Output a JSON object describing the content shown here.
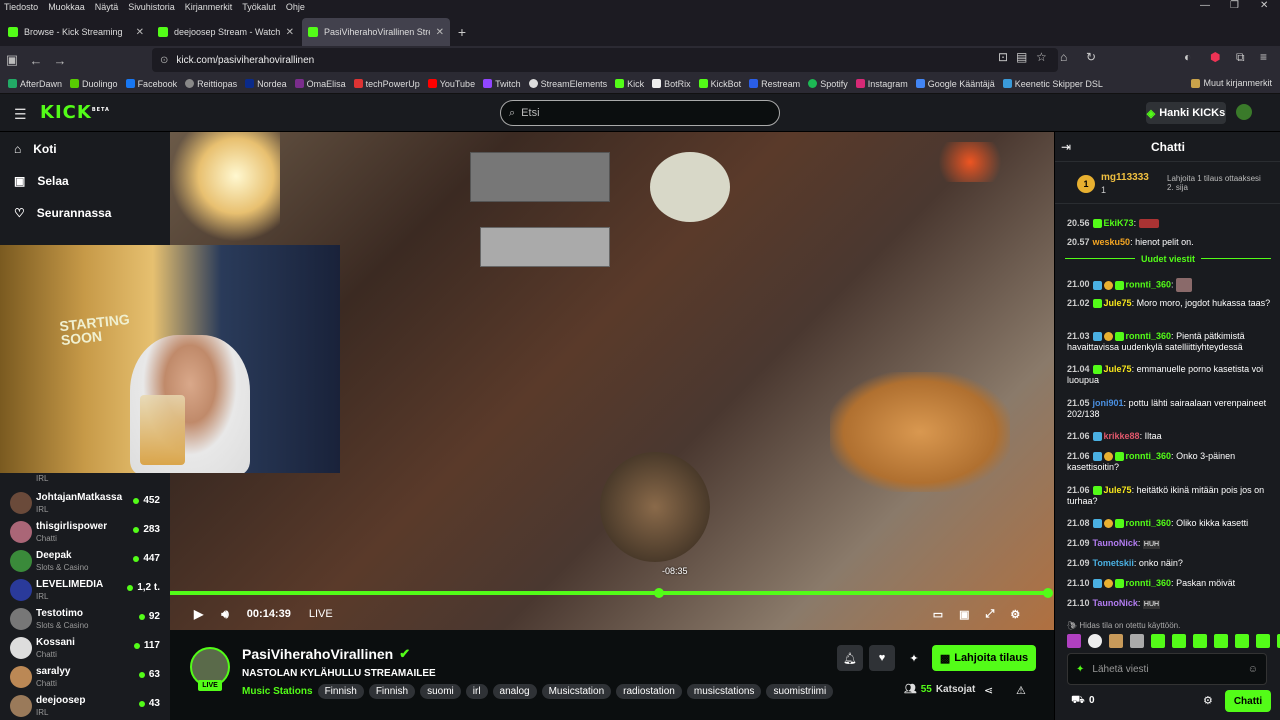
{
  "browser": {
    "menu": [
      "Tiedosto",
      "Muokkaa",
      "Näytä",
      "Sivuhistoria",
      "Kirjanmerkit",
      "Työkalut",
      "Ohje"
    ],
    "tabs": [
      {
        "title": "Browse - Kick Streaming"
      },
      {
        "title": "deejoosep Stream - Watch"
      },
      {
        "title": "PasiViherahoVirallinen Stream -"
      }
    ],
    "url": "kick.com/pasiviherahovirallinen",
    "bookmarks": [
      "AfterDawn",
      "Duolingo",
      "Facebook",
      "Reittiopas",
      "Nordea",
      "OmaElisa",
      "techPowerUp",
      "YouTube",
      "Twitch",
      "StreamElements",
      "Kick",
      "BotRix",
      "KickBot",
      "Restream",
      "Spotify",
      "Instagram",
      "Google Kääntäjä",
      "Keenetic Skipper DSL"
    ],
    "bookmarks_more": "Muut kirjanmerkit"
  },
  "header": {
    "logo": "KICK",
    "logo_sup": "BETA",
    "search_placeholder": "Etsi",
    "kicks_button": "Hanki KICKs"
  },
  "sidebar": {
    "nav": [
      {
        "label": "Koti",
        "icon": "home-icon"
      },
      {
        "label": "Selaa",
        "icon": "browse-icon"
      },
      {
        "label": "Seurannassa",
        "icon": "heart-icon"
      }
    ],
    "channels": [
      {
        "name": "",
        "category": "IRL",
        "viewers": ""
      },
      {
        "name": "JohtajanMatkassa",
        "category": "IRL",
        "viewers": "452"
      },
      {
        "name": "thisgirlispower",
        "category": "Chatti",
        "viewers": "283"
      },
      {
        "name": "Deepak",
        "category": "Slots & Casino",
        "viewers": "447"
      },
      {
        "name": "LEVELIMEDIA",
        "category": "IRL",
        "viewers": "1,2 t."
      },
      {
        "name": "Testotimo",
        "category": "Slots & Casino",
        "viewers": "92"
      },
      {
        "name": "Kossani",
        "category": "Chatti",
        "viewers": "117"
      },
      {
        "name": "saralyy",
        "category": "Chatti",
        "viewers": "63"
      },
      {
        "name": "deejoosep",
        "category": "IRL",
        "viewers": "43"
      }
    ]
  },
  "webcam": {
    "sign": "STARTING SOON"
  },
  "player": {
    "time": "00:14:39",
    "live": "LIVE",
    "seek_tooltip": "-08:35",
    "progress_fraction": 1.0,
    "seek_fraction": 0.555
  },
  "stream": {
    "channel": "PasiViherahoVirallinen",
    "title": "NASTOLAN KYLÄHULLU STREAMAILEE",
    "category": "Music Stations",
    "tags": [
      "Finnish",
      "Finnish",
      "suomi",
      "irl",
      "analog",
      "Musicstation",
      "radiostation",
      "musicstations",
      "suomistriimi"
    ],
    "live_badge": "LIVE",
    "subscribe_button": "Lahjoita tilaus",
    "viewers": "55",
    "viewers_label": "Katsojat"
  },
  "chat": {
    "title": "Chatti",
    "pinned": {
      "rank": "1",
      "user": "mg113333",
      "count": "1",
      "text": "Lahjoita 1 tilaus ottaaksesi 2. sija"
    },
    "new_messages": "Uudet viestit",
    "messages": [
      {
        "time": "20.56",
        "user": "EkiK73",
        "text": "",
        "color": "#53fc18"
      },
      {
        "time": "20.57",
        "user": "wesku50",
        "text": "hienot pelit on.",
        "color": "#f5a623"
      },
      {
        "time": "21.00",
        "user": "ronnti_360",
        "text": "",
        "color": "#53fc18"
      },
      {
        "time": "21.02",
        "user": "Jule75",
        "text": "Moro moro, jogdot hukassa taas?",
        "color": "#f8e71c"
      },
      {
        "time": "21.03",
        "user": "ronnti_360",
        "text": "Pientä pätkimistä havaittavissa uudenkylä satelliittiyhteydessä",
        "color": "#53fc18"
      },
      {
        "time": "21.04",
        "user": "Jule75",
        "text": "emmanuelle porno kasetista voi luoupua",
        "color": "#f8e71c"
      },
      {
        "time": "21.05",
        "user": "joni901",
        "text": "pottu lähti sairaalaan verenpaineet 202/138",
        "color": "#4a90e2"
      },
      {
        "time": "21.06",
        "user": "krikke88",
        "text": "Iltaa",
        "color": "#e0576b"
      },
      {
        "time": "21.06",
        "user": "ronnti_360",
        "text": "Onko 3-päinen kasettisoitin?",
        "color": "#53fc18"
      },
      {
        "time": "21.06",
        "user": "Jule75",
        "text": "heitätkö ikinä mitään pois jos on turhaa?",
        "color": "#f8e71c"
      },
      {
        "time": "21.08",
        "user": "ronnti_360",
        "text": "Oliko kikka kasetti",
        "color": "#53fc18"
      },
      {
        "time": "21.09",
        "user": "TaunoNick",
        "text": "HUH",
        "color": "#b27cf0"
      },
      {
        "time": "21.09",
        "user": "Tometskii",
        "text": "onko näin?",
        "color": "#4ab0e2"
      },
      {
        "time": "21.10",
        "user": "ronnti_360",
        "text": "Paskan möivät",
        "color": "#53fc18"
      },
      {
        "time": "21.10",
        "user": "TaunoNick",
        "text": "HUH",
        "color": "#b27cf0"
      }
    ],
    "slow_mode": "Hidas tila on otettu käyttöön.",
    "input_placeholder": "Lähetä viesti",
    "kicks_count": "0",
    "send_button": "Chatti"
  },
  "colors": {
    "accent": "#53fc18",
    "bg": "#0b0e0f",
    "panel": "#191b1f"
  }
}
